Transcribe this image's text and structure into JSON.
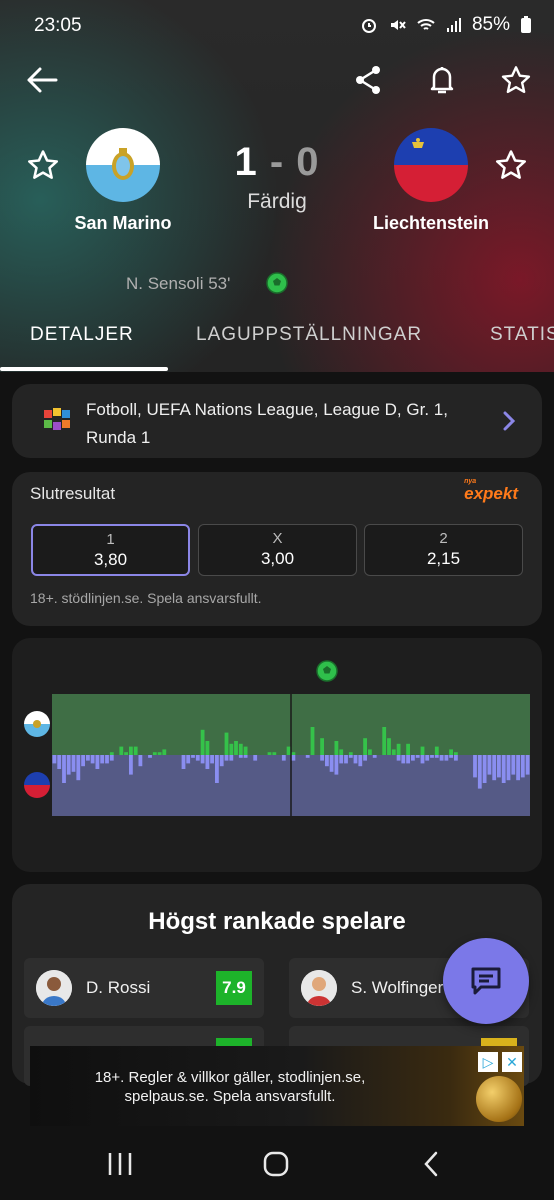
{
  "status_bar": {
    "time": "23:05",
    "battery": "85%",
    "icons": [
      "alarm-icon",
      "mute-icon",
      "wifi-icon",
      "signal-icon",
      "battery-icon"
    ]
  },
  "top_bar": {
    "icons": [
      "back-arrow-icon",
      "share-icon",
      "bell-icon",
      "star-icon"
    ]
  },
  "match": {
    "home_team": "San Marino",
    "away_team": "Liechtenstein",
    "home_score": "1",
    "separator": "-",
    "away_score": "0",
    "status": "Färdig",
    "scorer": "N. Sensoli 53'"
  },
  "tabs": [
    {
      "label": "DETALJER",
      "active": true
    },
    {
      "label": "LAGUPPSTÄLLNINGAR",
      "active": false
    },
    {
      "label": "STATIS",
      "active": false
    }
  ],
  "league": {
    "text": "Fotboll, UEFA Nations League, League D, Gr. 1, Runda 1",
    "icon": "nations-league-icon"
  },
  "odds": {
    "title": "Slutresultat",
    "brand_small": "nya",
    "brand": "expekt",
    "options": [
      {
        "label": "1",
        "value": "3,80",
        "selected": true
      },
      {
        "label": "X",
        "value": "3,00",
        "selected": false
      },
      {
        "label": "2",
        "value": "2,15",
        "selected": false
      }
    ],
    "disclaimer": "18+. stödlinjen.se. Spela ansvarsfullt."
  },
  "momentum": {
    "home_color": "#3f6e45",
    "away_color": "#555a86",
    "home_bar_color": "#35c24a",
    "away_bar_color": "#8a8ef0",
    "home": [
      0,
      0,
      0,
      0,
      0,
      0,
      0,
      0,
      0,
      0,
      0,
      0,
      1,
      0,
      3,
      1,
      3,
      3,
      0,
      0,
      0,
      1,
      1,
      2,
      0,
      0,
      0,
      0,
      0,
      0,
      0,
      9,
      5,
      0,
      0,
      0,
      8,
      4,
      5,
      4,
      3,
      0,
      0,
      0,
      0,
      1,
      1,
      0,
      0,
      3,
      1,
      0,
      0,
      0,
      10,
      0,
      6,
      0,
      0,
      5,
      2,
      0,
      1,
      0,
      0,
      6,
      2,
      0,
      0,
      10,
      6,
      2,
      4,
      0,
      4,
      0,
      0,
      3,
      0,
      0,
      3,
      0,
      0,
      2,
      1,
      0,
      0,
      0,
      0,
      0,
      0,
      0,
      0,
      0,
      0,
      0
    ],
    "away": [
      3,
      5,
      10,
      7,
      6,
      9,
      4,
      2,
      3,
      5,
      3,
      3,
      2,
      0,
      0,
      0,
      7,
      0,
      4,
      0,
      1,
      0,
      0,
      0,
      0,
      0,
      0,
      5,
      3,
      1,
      2,
      3,
      5,
      3,
      10,
      4,
      2,
      2,
      0,
      1,
      1,
      0,
      2,
      0,
      0,
      0,
      0,
      0,
      2,
      0,
      2,
      0,
      0,
      1,
      0,
      0,
      2,
      4,
      6,
      7,
      3,
      3,
      1,
      3,
      4,
      2,
      0,
      1,
      0,
      0,
      0,
      0,
      2,
      3,
      3,
      2,
      1,
      3,
      2,
      1,
      1,
      2,
      2,
      1,
      2,
      0,
      0,
      0,
      8,
      12,
      10,
      7,
      9,
      8,
      10,
      9,
      7,
      9,
      8,
      7
    ]
  },
  "top_players": {
    "title": "Högst rankade spelare",
    "players": [
      {
        "name": "D. Rossi",
        "rating": "7.9"
      },
      {
        "name": "S. Wolfinger",
        "rating": ""
      }
    ]
  },
  "ad": {
    "text": "18+. Regler & villkor gäller, stodlinjen.se, spelpaus.se. Spela ansvarsfullt.",
    "play_glyph": "▷",
    "close_glyph": "✕"
  }
}
